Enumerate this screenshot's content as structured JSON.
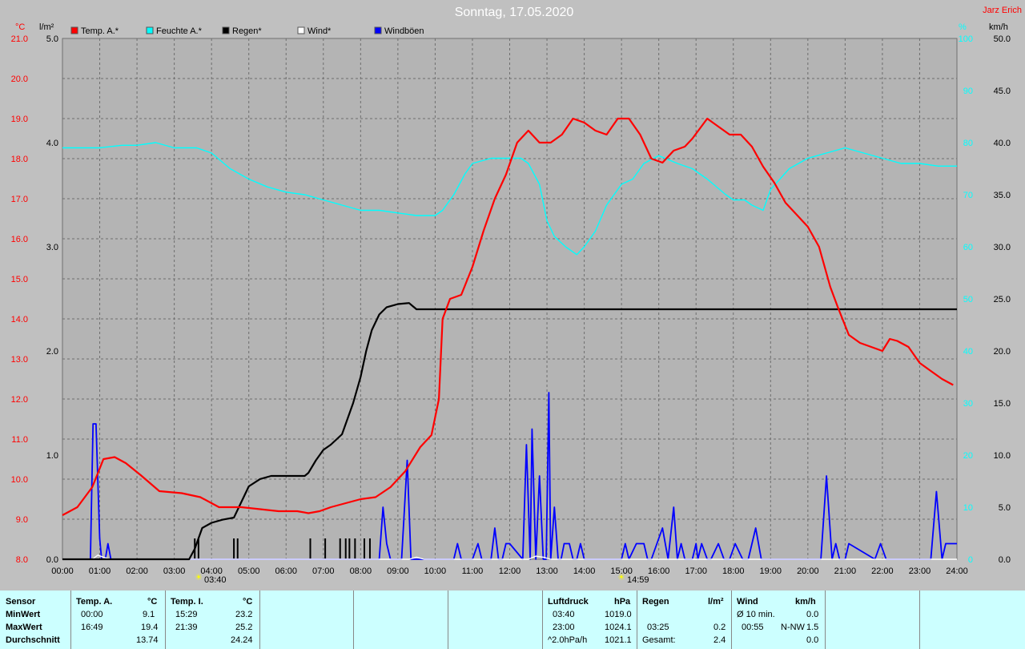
{
  "header": {
    "title": "Sonntag, 17.05.2020",
    "author": "Jarz Erich",
    "left_unit_temp": "°C",
    "left_unit_rain": "l/m²",
    "right_unit_pct": "%",
    "right_unit_wind": "km/h"
  },
  "legend": [
    {
      "label": "Temp. A.*",
      "color": "#ff0000"
    },
    {
      "label": "Feuchte A.*",
      "color": "#00ffff"
    },
    {
      "label": "Regen*",
      "color": "#000000"
    },
    {
      "label": "Wind*",
      "color": "#ffffff"
    },
    {
      "label": "Windböen",
      "color": "#0000ff"
    }
  ],
  "markers": {
    "sunrise": "03:40",
    "sunset": "14:59"
  },
  "chart_data": {
    "type": "line",
    "title": "Sonntag, 17.05.2020",
    "x_range": [
      0,
      24
    ],
    "x_ticks": [
      "00:00",
      "01:00",
      "02:00",
      "03:00",
      "04:00",
      "05:00",
      "06:00",
      "07:00",
      "08:00",
      "09:00",
      "10:00",
      "11:00",
      "12:00",
      "13:00",
      "14:00",
      "15:00",
      "16:00",
      "17:00",
      "18:00",
      "19:00",
      "20:00",
      "21:00",
      "22:00",
      "23:00",
      "24:00"
    ],
    "axes": {
      "temp": {
        "range": [
          8.0,
          21.0
        ],
        "ticks": [
          "8.0",
          "9.0",
          "10.0",
          "11.0",
          "12.0",
          "13.0",
          "14.0",
          "15.0",
          "16.0",
          "17.0",
          "18.0",
          "19.0",
          "20.0",
          "21.0"
        ],
        "color": "#ff0000"
      },
      "rain": {
        "range": [
          0.0,
          5.0
        ],
        "ticks": [
          "0.0",
          "1.0",
          "2.0",
          "3.0",
          "4.0",
          "5.0"
        ],
        "color": "#000000"
      },
      "humidity": {
        "range": [
          0,
          100
        ],
        "ticks": [
          "0",
          "10",
          "20",
          "30",
          "40",
          "50",
          "60",
          "70",
          "80",
          "90",
          "100"
        ],
        "color": "#00ffff"
      },
      "wind": {
        "range": [
          0.0,
          50.0
        ],
        "ticks": [
          "0.0",
          "5.0",
          "10.0",
          "15.0",
          "20.0",
          "25.0",
          "30.0",
          "35.0",
          "40.0",
          "45.0",
          "50.0"
        ],
        "color": "#000000"
      }
    },
    "grid": true,
    "series": [
      {
        "name": "Temp. A.*",
        "axis": "temp",
        "color": "#ff0000",
        "x": [
          0,
          0.4,
          0.8,
          1.1,
          1.4,
          1.7,
          2.1,
          2.6,
          3.2,
          3.7,
          4.2,
          4.8,
          5.3,
          5.8,
          6.3,
          6.6,
          6.9,
          7.2,
          7.6,
          8.0,
          8.4,
          8.8,
          9.2,
          9.6,
          9.9,
          10.1,
          10.2,
          10.4,
          10.7,
          11.0,
          11.3,
          11.6,
          11.9,
          12.2,
          12.5,
          12.8,
          13.1,
          13.4,
          13.7,
          14.0,
          14.3,
          14.6,
          14.9,
          15.2,
          15.5,
          15.8,
          16.1,
          16.4,
          16.7,
          16.9,
          17.3,
          17.6,
          17.9,
          18.2,
          18.5,
          18.8,
          19.1,
          19.4,
          19.7,
          20.0,
          20.3,
          20.6,
          20.8,
          21.1,
          21.4,
          21.7,
          22.0,
          22.2,
          22.4,
          22.7,
          23.0,
          23.3,
          23.6,
          23.9
        ],
        "y": [
          9.1,
          9.3,
          9.8,
          10.5,
          10.55,
          10.4,
          10.1,
          9.7,
          9.65,
          9.55,
          9.3,
          9.3,
          9.25,
          9.2,
          9.2,
          9.15,
          9.2,
          9.3,
          9.4,
          9.5,
          9.55,
          9.8,
          10.2,
          10.8,
          11.1,
          12.0,
          14.0,
          14.5,
          14.6,
          15.3,
          16.2,
          17.0,
          17.6,
          18.4,
          18.7,
          18.4,
          18.4,
          18.6,
          19.0,
          18.9,
          18.7,
          18.6,
          19.0,
          19.0,
          18.6,
          18.0,
          17.9,
          18.2,
          18.3,
          18.5,
          19.0,
          18.8,
          18.6,
          18.6,
          18.3,
          17.8,
          17.4,
          16.9,
          16.6,
          16.3,
          15.8,
          14.8,
          14.3,
          13.6,
          13.4,
          13.3,
          13.2,
          13.5,
          13.45,
          13.3,
          12.9,
          12.7,
          12.5,
          12.35
        ]
      },
      {
        "name": "Feuchte A.*",
        "axis": "humidity",
        "color": "#00ffff",
        "x": [
          0,
          1.0,
          1.6,
          2.0,
          2.5,
          3.0,
          3.6,
          4.0,
          4.5,
          5.0,
          5.5,
          6.0,
          6.5,
          7.0,
          7.5,
          8.0,
          8.5,
          9.0,
          9.5,
          10.0,
          10.2,
          10.5,
          10.8,
          11.0,
          11.5,
          12.0,
          12.3,
          12.5,
          12.8,
          13.0,
          13.2,
          13.5,
          13.8,
          14.0,
          14.3,
          14.6,
          15.0,
          15.3,
          15.6,
          16.0,
          16.5,
          16.9,
          17.3,
          17.8,
          18.0,
          18.3,
          18.5,
          18.8,
          19.0,
          19.5,
          20.0,
          20.5,
          21.0,
          21.5,
          22.0,
          22.5,
          23.0,
          23.5,
          24.0
        ],
        "y": [
          79,
          79,
          79.5,
          79.5,
          80,
          79,
          79,
          78,
          75,
          73,
          71.5,
          70.5,
          70,
          69,
          68,
          67,
          67,
          66.5,
          66,
          66,
          67,
          70,
          74,
          76,
          77,
          77,
          77,
          76,
          72,
          65,
          62,
          60,
          58.5,
          60,
          63,
          68,
          72,
          73,
          76,
          77.5,
          76,
          75,
          73,
          70,
          69,
          69,
          68,
          67,
          71,
          75,
          77,
          78,
          79,
          78,
          77,
          76,
          76,
          75.5,
          75.5
        ]
      },
      {
        "name": "Regen*",
        "axis": "rain",
        "color": "#000000",
        "x": [
          0,
          3.4,
          3.55,
          3.75,
          4.0,
          4.3,
          4.6,
          4.8,
          5.0,
          5.3,
          5.6,
          6.0,
          6.5,
          6.6,
          6.8,
          7.0,
          7.2,
          7.5,
          7.8,
          8.0,
          8.15,
          8.3,
          8.5,
          8.7,
          9.0,
          9.3,
          9.5,
          10.0,
          24.0
        ],
        "y": [
          0,
          0,
          0.1,
          0.3,
          0.35,
          0.38,
          0.4,
          0.55,
          0.7,
          0.77,
          0.8,
          0.8,
          0.8,
          0.83,
          0.95,
          1.05,
          1.1,
          1.2,
          1.5,
          1.75,
          2.0,
          2.2,
          2.35,
          2.42,
          2.45,
          2.46,
          2.4,
          2.4,
          2.4
        ]
      },
      {
        "name": "Windböen",
        "axis": "wind",
        "color": "#0000ff",
        "x": [
          0,
          0.75,
          0.82,
          0.9,
          1.0,
          1.05,
          1.15,
          1.22,
          1.3,
          1.4,
          8.5,
          8.6,
          8.7,
          8.8,
          9.1,
          9.25,
          9.35,
          9.45,
          10.5,
          10.6,
          10.7,
          11.0,
          11.15,
          11.25,
          11.5,
          11.6,
          11.7,
          11.8,
          11.9,
          12.0,
          12.35,
          12.45,
          12.55,
          12.6,
          12.7,
          12.8,
          12.9,
          12.98,
          13.05,
          13.1,
          13.2,
          13.3,
          13.38,
          13.46,
          13.6,
          13.7,
          13.8,
          13.9,
          14.0,
          15.0,
          15.1,
          15.2,
          15.4,
          15.6,
          15.7,
          15.8,
          16.1,
          16.25,
          16.4,
          16.5,
          16.6,
          16.7,
          16.9,
          17.0,
          17.05,
          17.15,
          17.3,
          17.4,
          17.6,
          17.75,
          17.9,
          18.05,
          18.25,
          18.4,
          18.6,
          18.75,
          20.35,
          20.5,
          20.65,
          20.75,
          20.85,
          21.0,
          21.1,
          21.8,
          21.95,
          22.1,
          23.3,
          23.45,
          23.6,
          23.7,
          23.8,
          24.0
        ],
        "y": [
          0,
          0,
          13,
          13,
          2,
          0,
          0,
          1.5,
          0,
          0,
          0,
          5,
          1.5,
          0,
          0,
          9.5,
          0,
          0,
          0,
          1.5,
          0,
          0,
          1.5,
          0,
          0,
          3,
          0,
          0,
          1.5,
          1.5,
          0,
          11,
          0,
          12.5,
          0,
          8,
          0,
          0,
          16,
          0,
          5,
          0,
          0,
          1.5,
          1.5,
          0,
          0,
          1.5,
          0,
          0,
          1.5,
          0,
          1.5,
          1.5,
          0,
          0,
          3,
          0,
          5,
          0,
          1.5,
          0,
          0,
          1.5,
          0,
          1.5,
          0,
          0,
          1.5,
          0,
          0,
          1.5,
          0,
          0,
          3,
          0,
          0,
          8,
          0,
          1.5,
          0,
          0,
          1.5,
          0,
          1.5,
          0,
          0,
          6.5,
          0,
          1.5,
          1.5,
          1.5
        ]
      },
      {
        "name": "Wind*",
        "axis": "wind",
        "color": "#ffffff",
        "x": [
          0,
          0.8,
          0.95,
          1.1,
          1.3,
          9.3,
          9.5,
          9.7,
          12.5,
          12.7,
          12.9,
          13.1,
          23.8,
          24.0
        ],
        "y": [
          0,
          0,
          0.4,
          0.2,
          0,
          0,
          0.2,
          0,
          0,
          0.3,
          0.2,
          0,
          0,
          0
        ]
      }
    ],
    "rain_ticks_x": [
      3.55,
      3.65,
      4.6,
      4.7,
      6.65,
      7.05,
      7.45,
      7.6,
      7.7,
      7.85,
      8.1,
      8.25
    ]
  },
  "table": {
    "sensor": {
      "head": "Sensor",
      "min": "MinWert",
      "max": "MaxWert",
      "avg": "Durchschnitt"
    },
    "temp_a": {
      "head": "Temp. A.",
      "unit": "°C",
      "min_time": "00:00",
      "min_val": "9.1",
      "max_time": "16:49",
      "max_val": "19.4",
      "avg": "13.74"
    },
    "temp_i": {
      "head": "Temp. I.",
      "unit": "°C",
      "min_time": "15:29",
      "min_val": "23.2",
      "max_time": "21:39",
      "max_val": "25.2",
      "avg": "24.24"
    },
    "pressure": {
      "head": "Luftdruck",
      "unit": "hPa",
      "min_time": "03:40",
      "min_val": "1019.0",
      "max_time": "23:00",
      "max_val": "1024.1",
      "trend_label": "^2.0hPa/h",
      "avg": "1021.1"
    },
    "rain": {
      "head": "Regen",
      "unit": "l/m²",
      "max_time": "03:25",
      "max_val": "0.2",
      "total_label": "Gesamt:",
      "total": "2.4"
    },
    "wind": {
      "head": "Wind",
      "unit": "km/h",
      "min_label": "Ø 10 min.",
      "min_val": "0.0",
      "max_time": "00:55",
      "max_dir": "N-NW",
      "max_val": "1.5",
      "avg": "0.0"
    }
  }
}
